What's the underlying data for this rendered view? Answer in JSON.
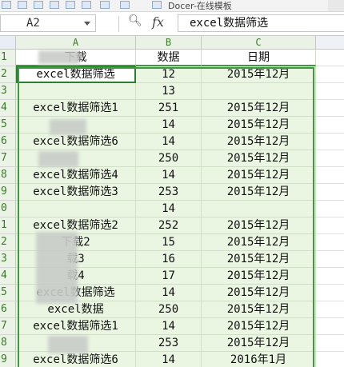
{
  "toolbar": {
    "title": "Docer-在线模板"
  },
  "formula_bar": {
    "name_box": "A2",
    "fx_label": "fx",
    "zoom_icon": "zoom-icon",
    "content": "excel数据筛选"
  },
  "columns": [
    "A",
    "B",
    "C"
  ],
  "header_row": {
    "row": "1",
    "a": "下载",
    "b": "数据",
    "c": "日期"
  },
  "rows": [
    {
      "row": "2",
      "a": "excel数据筛选",
      "b": "12",
      "c": "2015年12月"
    },
    {
      "row": "3",
      "a": "",
      "b": "13",
      "c": ""
    },
    {
      "row": "4",
      "a": "excel数据筛选1",
      "b": "251",
      "c": "2015年12月"
    },
    {
      "row": "5",
      "a": "",
      "b": "14",
      "c": "2015年12月"
    },
    {
      "row": "6",
      "a": "excel数据筛选6",
      "b": "14",
      "c": "2015年12月"
    },
    {
      "row": "7",
      "a": "",
      "b": "250",
      "c": "2015年12月"
    },
    {
      "row": "8",
      "a": "excel数据筛选4",
      "b": "14",
      "c": "2015年12月"
    },
    {
      "row": "9",
      "a": "excel数据筛选3",
      "b": "253",
      "c": "2015年12月"
    },
    {
      "row": "0",
      "a": "",
      "b": "14",
      "c": ""
    },
    {
      "row": "1",
      "a": "excel数据筛选2",
      "b": "252",
      "c": "2015年12月"
    },
    {
      "row": "2",
      "a": "下载2",
      "b": "15",
      "c": "2015年12月"
    },
    {
      "row": "3",
      "a": "载3",
      "b": "16",
      "c": "2015年12月"
    },
    {
      "row": "4",
      "a": "载4",
      "b": "17",
      "c": "2015年12月"
    },
    {
      "row": "5",
      "a": "excel数据筛选",
      "b": "14",
      "c": "2015年12月"
    },
    {
      "row": "6",
      "a": "excel数据",
      "b": "250",
      "c": "2015年12月"
    },
    {
      "row": "7",
      "a": "excel数据筛选1",
      "b": "14",
      "c": "2015年12月"
    },
    {
      "row": "8",
      "a": "",
      "b": "253",
      "c": "2015年12月"
    },
    {
      "row": "9",
      "a": "excel数据筛选6",
      "b": "14",
      "c": "2016年1月"
    }
  ]
}
